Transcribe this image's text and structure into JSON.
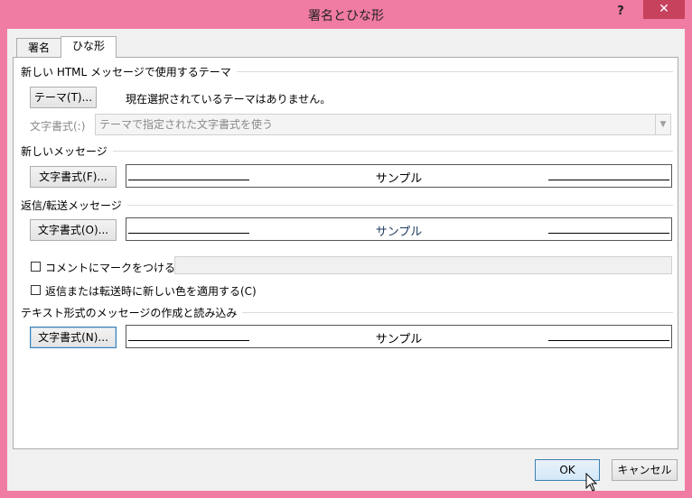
{
  "window": {
    "title": "署名とひな形",
    "help_label": "?",
    "close_label": "✕"
  },
  "tabs": [
    {
      "label": "署名",
      "selected": false
    },
    {
      "label": "ひな形",
      "selected": true
    }
  ],
  "theme_section": {
    "heading": "新しい HTML メッセージで使用するテーマ",
    "theme_button": "テーマ(T)...",
    "theme_status": "現在選択されているテーマはありません。",
    "font_label": "文字書式(:)",
    "font_select_value": "テーマで指定された文字書式を使う"
  },
  "new_message": {
    "heading": "新しいメッセージ",
    "font_button": "文字書式(F)...",
    "sample": "サンプル"
  },
  "reply_forward": {
    "heading": "返信/転送メッセージ",
    "font_button": "文字書式(O)...",
    "sample": "サンプル",
    "mark_comments_label": "コメントにマークをつける(M):",
    "mark_comments_checked": false,
    "mark_comments_value": "",
    "new_color_label": "返信または転送時に新しい色を適用する(C)",
    "new_color_checked": false
  },
  "plain_text": {
    "heading": "テキスト形式のメッセージの作成と読み込み",
    "font_button": "文字書式(N)...",
    "sample": "サンプル"
  },
  "footer": {
    "ok_label": "OK",
    "cancel_label": "キャンセル"
  },
  "colors": {
    "window_frame": "#f07ba3",
    "close_button": "#c7425c",
    "dialog_background": "#f0f0f0"
  }
}
